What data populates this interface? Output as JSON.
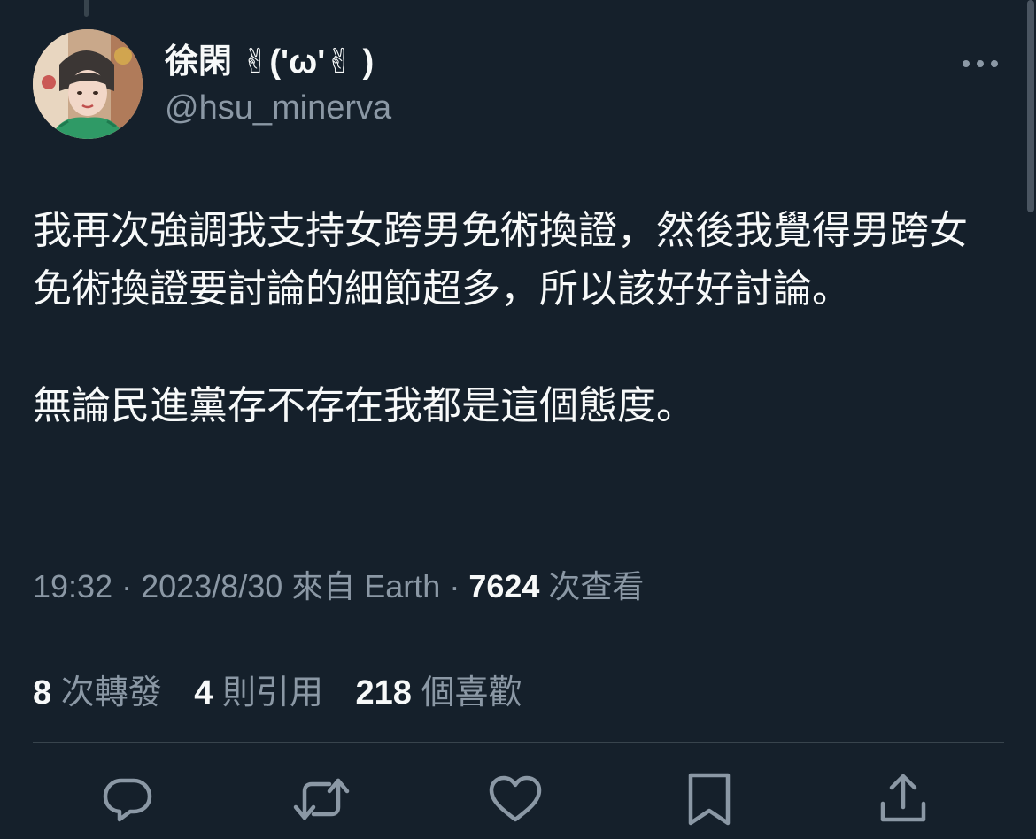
{
  "tweet": {
    "author": {
      "display_name": "徐閑 ✌('ω'✌ )",
      "handle": "@hsu_minerva",
      "avatar": "profile-photo"
    },
    "body": {
      "paragraph_1": "我再次強調我支持女跨男免術換證，然後我覺得男跨女免術換證要討論的細節超多，所以該好好討論。",
      "paragraph_2": "無論民進黨存不存在我都是這個態度。"
    },
    "meta": {
      "time": "19:32",
      "separator": " · ",
      "date": "2023/8/30",
      "source": "來自 Earth",
      "views_count": "7624",
      "views_label": " 次查看"
    },
    "stats": {
      "retweets": {
        "count": "8",
        "label": " 次轉發"
      },
      "quotes": {
        "count": "4",
        "label": " 則引用"
      },
      "likes": {
        "count": "218",
        "label": " 個喜歡"
      }
    },
    "actions": [
      {
        "icon": "reply-icon"
      },
      {
        "icon": "retweet-icon"
      },
      {
        "icon": "like-icon"
      },
      {
        "icon": "bookmark-icon"
      },
      {
        "icon": "share-icon"
      }
    ]
  },
  "colors": {
    "background": "#15202b",
    "text_primary": "#f7f9f9",
    "text_secondary": "#8b98a5",
    "divider": "#38444d"
  }
}
